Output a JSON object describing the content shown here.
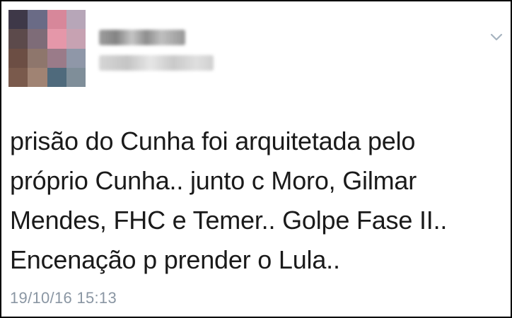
{
  "tweet": {
    "author_name": "",
    "author_handle": "",
    "text": "prisão do Cunha foi arquitetada pelo\npróprio Cunha.. junto c Moro, Gilmar\nMendes, FHC e Temer.. Golpe Fase II..\nEncenação p prender o Lula..",
    "timestamp": "19/10/16 15:13"
  },
  "icons": {
    "menu": "chevron-down-icon"
  },
  "colors": {
    "text": "#1a1a1a",
    "timestamp": "#8a96a3",
    "chevron": "#a6b3bf",
    "border": "#000000"
  },
  "avatar_pixels": [
    "#3e3848",
    "#6a6b86",
    "#d7879a",
    "#b7a6b8",
    "#5c4a4b",
    "#7e6c78",
    "#e597a9",
    "#c7a2b2",
    "#6c4e44",
    "#8e766c",
    "#9a7b89",
    "#8f97a8",
    "#7a5a4c",
    "#a08373",
    "#4f6a7c",
    "#7f8e99"
  ]
}
